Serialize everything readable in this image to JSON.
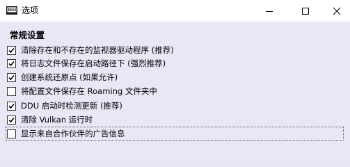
{
  "window": {
    "title": "选项"
  },
  "icons": {
    "app": "app-icon",
    "minimize": "minimize-icon",
    "maximize": "maximize-icon",
    "close": "close-icon",
    "check": "checkmark-icon"
  },
  "settings": {
    "section_title": "常规设置",
    "options": [
      {
        "label": "清除存在和不存在的监视器驱动程序 (推荐)",
        "checked": true
      },
      {
        "label": "将日志文件保存在启动路径下 (强烈推荐)",
        "checked": true
      },
      {
        "label": "创建系统还原点 (如果允许)",
        "checked": true
      },
      {
        "label": "将配置文件保存在 Roaming 文件夹中",
        "checked": false
      },
      {
        "label": "DDU 启动时检测更新 (推荐)",
        "checked": true
      },
      {
        "label": "清除 Vulkan 运行时",
        "checked": true
      },
      {
        "label": "显示来自合作伙伴的广告信息",
        "checked": false
      }
    ]
  }
}
